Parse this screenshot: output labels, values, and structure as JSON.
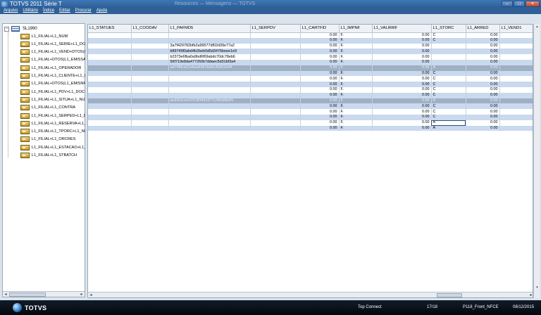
{
  "window": {
    "title": "TOTVS 2011 Série T",
    "title_ghost": "Resources — Mensagens — TOTVS"
  },
  "menu": [
    "Arquivo",
    "Utilitário",
    "Índice",
    "Editar",
    "Procurar",
    "Ajuda"
  ],
  "tree": {
    "root": "SL1990",
    "items": [
      "L1_FILIAL+L1_NUM",
      "L1_FILIAL+L1_SERIE+L1_DOC",
      "L1_FILIAL+L1_VEND+DTOS(L1_EMISSAO)",
      "L1_FILIAL+DTOS(L1_EMISSAO)",
      "L1_FILIAL+L1_OPERADOR",
      "L1_FILIAL+L1_CLIENTE+L1_LOJA",
      "L1_FILIAL+DTOS(L1_EMISNF)",
      "L1_FILIAL+L1_PDV+L1_DOC",
      "L1_FILIAL+L1_SITUA+L1_NUM",
      "L1_FILIAL+L1_CONTRA",
      "L1_FILIAL+L1_SERPED+L1_DOCPED",
      "L1_FILIAL+L1_RESERVA+L1_NUM",
      "L1_FILIAL+L1_TPORC+L1_NUM",
      "L1_FILIAL+L1_ORCRES",
      "L1_FILIAL+L1_ESTACAO+L1_NUM",
      "L1_FILIAL+L1_STBATCH"
    ]
  },
  "grid": {
    "columns": [
      "L1_STATUES",
      "L1_COODAV",
      "L1_PAFMD5",
      "L1_SERPDV",
      "L1_CARTFID",
      "L1_IMPNF",
      "L1_VALIRRF",
      "L1_STORC",
      "L1_ARRED",
      "L1_VEND1"
    ],
    "rows": [
      [
        "",
        "",
        "",
        "",
        "0.00",
        "F.",
        "0.00",
        "C",
        "0.00",
        ""
      ],
      [
        "",
        "",
        "",
        "",
        "0.00",
        "F.",
        "0.00",
        "C",
        "0.00",
        ""
      ],
      [
        "",
        "",
        "3a7f429782bfb2a99577df02d39e77a2",
        "",
        "0.00",
        "F.",
        "0.00",
        "",
        "0.00",
        ""
      ],
      [
        "",
        "",
        "b89749f0abd4b2beb0d5d3476beee1e9",
        "",
        "0.00",
        "F.",
        "0.00",
        "",
        "0.00",
        ""
      ],
      [
        "",
        "",
        "b2373e6fba0a9bd6f69abdc70dc78eb6",
        "",
        "0.00",
        "F.",
        "0.00",
        "",
        "0.00",
        ""
      ],
      [
        "",
        "",
        "56f719e8da477260b7ddaec5d31bf3a4",
        "",
        "0.00",
        "F.",
        "0.00",
        "",
        "0.00",
        ""
      ],
      [
        "",
        "",
        "ad748fca01ebea49b1bb5c35d53a44",
        "",
        "0.00",
        "F.",
        "0.00",
        "A",
        "0.00",
        ""
      ],
      [
        "",
        "",
        "",
        "",
        "0.00",
        "F.",
        "0.00",
        "C",
        "0.00",
        ""
      ],
      [
        "",
        "",
        "",
        "",
        "0.00",
        "F.",
        "0.00",
        "C",
        "0.00",
        ""
      ],
      [
        "",
        "",
        "",
        "",
        "0.00",
        "F.",
        "0.00",
        "C",
        "0.00",
        ""
      ],
      [
        "",
        "",
        "",
        "",
        "0.00",
        "F.",
        "0.00",
        "C",
        "0.00",
        ""
      ],
      [
        "",
        "",
        "",
        "",
        "0.00",
        "F.",
        "0.00",
        "C",
        "0.00",
        ""
      ],
      [
        "",
        "",
        "acd3e1cec4761ff3451677c365d6b0f1",
        "",
        "0.00",
        "F.",
        "0.00",
        "A",
        "0.00",
        ""
      ],
      [
        "",
        "",
        "",
        "",
        "0.00",
        "F.",
        "0.00",
        "C",
        "0.00",
        ""
      ],
      [
        "",
        "",
        "",
        "",
        "0.00",
        "F.",
        "0.00",
        "C",
        "0.00",
        ""
      ],
      [
        "",
        "",
        "",
        "",
        "0.00",
        "F.",
        "0.00",
        "C",
        "0.00",
        ""
      ],
      [
        "",
        "",
        "",
        "",
        "0.00",
        "F.",
        "0.00",
        "A",
        "0.00",
        ""
      ],
      [
        "",
        "",
        "",
        "",
        "0.00",
        "F.",
        "0.00",
        "A",
        "0.00",
        ""
      ]
    ],
    "selected_rows": [
      6,
      12
    ],
    "focused_cell": {
      "row": 16,
      "col": 7
    }
  },
  "statusbar": {
    "logo": "TOTVS",
    "connection": "Top Connect",
    "record": "17/18",
    "environment": "P118_Front_NFCE",
    "date": "08/12/2015"
  }
}
